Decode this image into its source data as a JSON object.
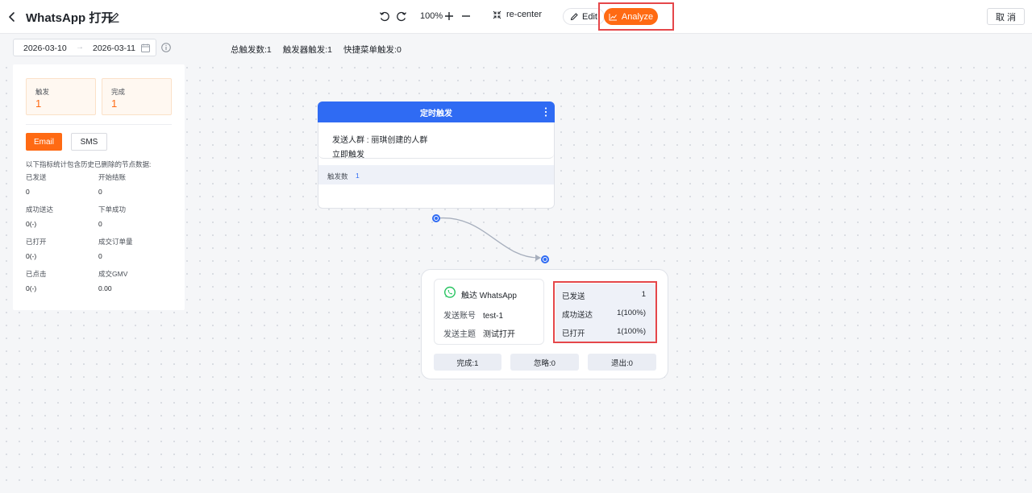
{
  "header": {
    "title": "WhatsApp 打开",
    "zoom": "100%",
    "recenter_label": "re-center",
    "edit_label": "Edit",
    "analyze_label": "Analyze",
    "cancel_label": "取 消",
    "accent": "#ff6a13"
  },
  "filter": {
    "date_start": "2026-03-10",
    "date_sep": "→",
    "date_end": "2026-03-11",
    "stats": [
      "总触发数:1",
      "触发器触发:1",
      "快捷菜单触发:0"
    ]
  },
  "left_panel": {
    "cards": [
      {
        "label": "触发",
        "value": "1"
      },
      {
        "label": "完成",
        "value": "1"
      }
    ],
    "tabs": [
      {
        "label": "Email",
        "active": true
      },
      {
        "label": "SMS",
        "active": false
      }
    ],
    "note": "以下指标统计包含历史已删除的节点数据:",
    "metrics": [
      {
        "label": "已发送",
        "value": "0"
      },
      {
        "label": "开始结账",
        "value": "0"
      },
      {
        "label": "成功送达",
        "value": "0(-)"
      },
      {
        "label": "下单成功",
        "value": "0"
      },
      {
        "label": "已打开",
        "value": "0(-)"
      },
      {
        "label": "成交订单量",
        "value": "0"
      },
      {
        "label": "已点击",
        "value": "0(-)"
      },
      {
        "label": "成交GMV",
        "value": "0.00"
      }
    ]
  },
  "trigger_node": {
    "title": "定时触发",
    "header_color": "#2f6bf3",
    "audience": "发送人群 : 丽琪创建的人群",
    "timing": "立即触发",
    "count_label": "触发数",
    "count_value": "1"
  },
  "action_node": {
    "name": "触达 WhatsApp",
    "icon": "whatsapp-icon",
    "account_label": "发送账号",
    "account_value": "test-1",
    "subject_label": "发送主题",
    "subject_value": "测试打开",
    "stats": [
      {
        "label": "已发送",
        "value": "1"
      },
      {
        "label": "成功送达",
        "value": "1(100%)"
      },
      {
        "label": "已打开",
        "value": "1(100%)"
      }
    ],
    "footer": [
      "完成:1",
      "忽略:0",
      "退出:0"
    ]
  }
}
